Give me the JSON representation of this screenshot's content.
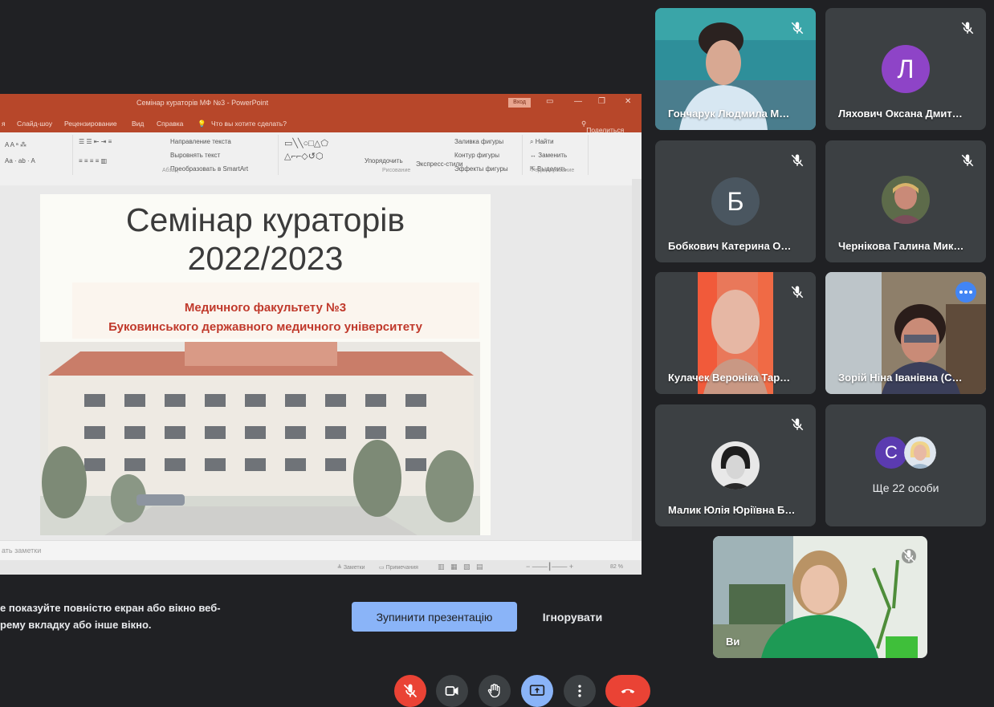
{
  "presentation": {
    "window_title": "Семінар кураторів МФ №3 - PowerPoint",
    "signin": "Вход",
    "menu": [
      "я",
      "Слайд-шоу",
      "Рецензирование",
      "Вид",
      "Справка",
      "Что вы хотите сделать?",
      "Поделиться"
    ],
    "ribbon": {
      "groups": [
        "Абзац",
        "Рисование",
        "Редактирование"
      ],
      "items": [
        "Направление текста",
        "Выровнять текст",
        "Преобразовать в SmartArt",
        "Упорядочить",
        "Экспресс-стили",
        "Заливка фигуры",
        "Контур фигуры",
        "Эффекты фигуры",
        "Найти",
        "Заменить",
        "Выделить"
      ]
    },
    "slide": {
      "title_line1": "Семінар кураторів",
      "title_line2": "2022/2023",
      "subtitle_line1": "Медичного факультету №3",
      "subtitle_line2": "Буковинського державного медичного університету"
    },
    "notes_placeholder": "ать заметки",
    "status": {
      "notes": "Заметки",
      "comments": "Примечания",
      "zoom": "82 %"
    }
  },
  "warning": {
    "line1": "е показуйте повністю екран або вікно веб-",
    "line2": "рему вкладку або інше вікно."
  },
  "buttons": {
    "stop_presentation": "Зупинити презентацію",
    "ignore": "Ігнорувати"
  },
  "participants": [
    {
      "name": "Гончарук Людмила М…",
      "muted": true,
      "type": "video"
    },
    {
      "name": "Ляхович Оксана Дмит…",
      "muted": true,
      "type": "avatar",
      "initial": "Л",
      "color": "#8e44c7"
    },
    {
      "name": "Бобкович Катерина О…",
      "muted": true,
      "type": "avatar",
      "initial": "Б",
      "color": "#4a5660"
    },
    {
      "name": "Чернікова Галина Мик…",
      "muted": true,
      "type": "photo"
    },
    {
      "name": "Кулачек Вероніка Тар…",
      "muted": true,
      "type": "video"
    },
    {
      "name": "Зорій Ніна Іванівна (С…",
      "muted": false,
      "type": "video",
      "active": true
    },
    {
      "name": "Малик Юлія Юріївна Б…",
      "muted": true,
      "type": "photo"
    },
    {
      "name": "Ще 22 особи",
      "muted": false,
      "type": "group",
      "initial": "С",
      "color": "#5b3bb0"
    }
  ],
  "self": {
    "name": "Ви",
    "muted": true
  },
  "controls": {
    "mic": "mic-off-icon",
    "camera": "camera-icon",
    "hand": "raise-hand-icon",
    "present": "present-screen-icon",
    "more": "more-options-icon",
    "leave": "leave-call-icon"
  },
  "colors": {
    "accent": "#8ab4f8",
    "danger": "#ea4335",
    "bg": "#202124",
    "tile": "#3c4043"
  }
}
